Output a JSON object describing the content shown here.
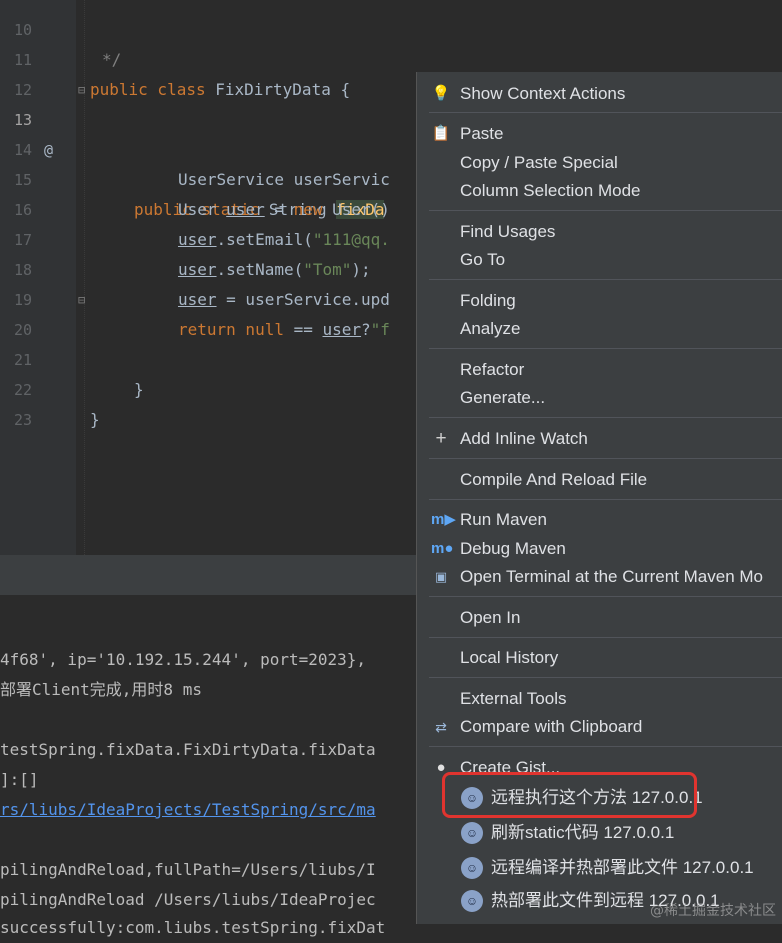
{
  "editor": {
    "lines": [
      {
        "n": "10",
        "text": "*/"
      },
      {
        "n": "11",
        "text": "public class FixDirtyData {"
      },
      {
        "n": "12",
        "text": ""
      },
      {
        "n": "13",
        "text": "public static String fixDa"
      },
      {
        "n": "14",
        "text": "UserService userServic"
      },
      {
        "n": "15",
        "text": "User user = new User()"
      },
      {
        "n": "16",
        "text": "user.setEmail(\"111@qq."
      },
      {
        "n": "17",
        "text": "user.setName(\"Tom\");"
      },
      {
        "n": "18",
        "text": "user = userService.upd"
      },
      {
        "n": "19",
        "text": "return null == user?\"f"
      },
      {
        "n": "20",
        "text": "}"
      },
      {
        "n": "21",
        "text": ""
      },
      {
        "n": "22",
        "text": "}"
      },
      {
        "n": "23",
        "text": ""
      }
    ],
    "at_marker": "@"
  },
  "console": {
    "lines": [
      "4f68', ip='10.192.15.244', port=2023},",
      "部署Client完成,用时8 ms",
      "",
      "testSpring.fixData.FixDirtyData.fixData",
      "]:[]",
      "rs/liubs/IdeaProjects/TestSpring/src/ma",
      "",
      "pilingAndReload,fullPath=/Users/liubs/I",
      "pilingAndReload /Users/liubs/IdeaProjec",
      "successfully:com.liubs.testSpring.fixDat"
    ]
  },
  "menu": {
    "items": [
      {
        "label": "Show Context Actions",
        "icon": "bulb-icon"
      },
      {
        "label": "Paste",
        "icon": "clipboard-icon"
      },
      {
        "label": "Copy / Paste Special",
        "icon": ""
      },
      {
        "label": "Column Selection Mode",
        "icon": ""
      },
      {
        "label": "Find Usages",
        "icon": ""
      },
      {
        "label": "Go To",
        "icon": ""
      },
      {
        "label": "Folding",
        "icon": ""
      },
      {
        "label": "Analyze",
        "icon": ""
      },
      {
        "label": "Refactor",
        "icon": ""
      },
      {
        "label": "Generate...",
        "icon": ""
      },
      {
        "label": "Add Inline Watch",
        "icon": "watch-add-icon"
      },
      {
        "label": "Compile And Reload File",
        "icon": ""
      },
      {
        "label": "Run Maven",
        "icon": "maven-run-icon"
      },
      {
        "label": "Debug Maven",
        "icon": "maven-debug-icon"
      },
      {
        "label": "Open Terminal at the Current Maven Mo",
        "icon": "terminal-icon"
      },
      {
        "label": "Open In",
        "icon": ""
      },
      {
        "label": "Local History",
        "icon": ""
      },
      {
        "label": "External Tools",
        "icon": ""
      },
      {
        "label": "Compare with Clipboard",
        "icon": "compare-icon"
      },
      {
        "label": "Create Gist...",
        "icon": "github-icon"
      }
    ],
    "submenu": [
      {
        "label": "远程执行这个方法 127.0.0.1",
        "icon": "avatar-icon"
      },
      {
        "label": "刷新static代码 127.0.0.1",
        "icon": "avatar-icon"
      },
      {
        "label": "远程编译并热部署此文件 127.0.0.1",
        "icon": "avatar-icon"
      },
      {
        "label": "热部署此文件到远程 127.0.0.1",
        "icon": "avatar-icon"
      }
    ]
  },
  "watermark": "@稀土掘金技术社区",
  "colors": {
    "highlight_box": "#e0342f",
    "menu_bg": "#3c3f41",
    "editor_bg": "#2b2b2b"
  }
}
